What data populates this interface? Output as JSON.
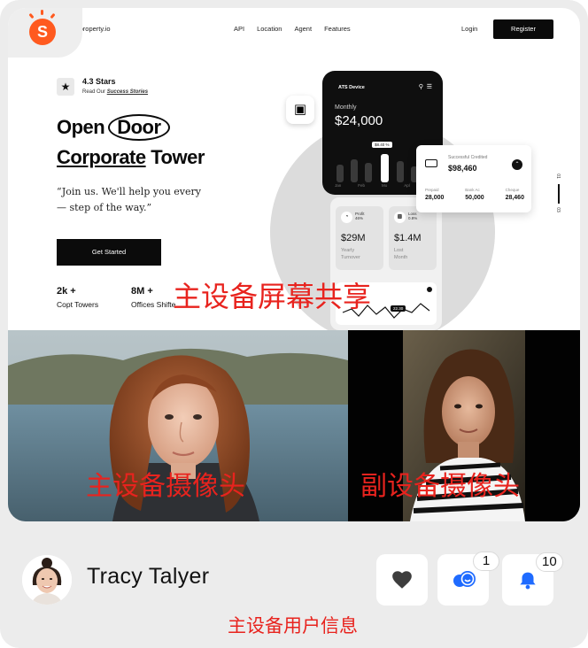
{
  "app": {
    "logo_icon": "app-logo-icon"
  },
  "website": {
    "email": "@property.io",
    "nav": [
      "API",
      "Location",
      "Agent",
      "Features"
    ],
    "login": "Login",
    "register": "Register",
    "rating": {
      "title": "4.3 Stars",
      "prefix": "Read Our ",
      "link": "Success Stories"
    },
    "hero": {
      "word_open": "Open",
      "word_door": "Door",
      "word_corporate": "Corporate",
      "word_tower": "Tower",
      "quote_line1": "“Join us. We'll help you every",
      "quote_line2": "—  step of the way.”",
      "cta": "Get Started"
    },
    "stats": [
      {
        "num": "2k +",
        "label": "Copt Towers"
      },
      {
        "num": "8M +",
        "label": "Offices Shifte"
      }
    ],
    "mockup": {
      "brand": "ATS Device",
      "monthly_label": "Monthly",
      "monthly_amount": "$24,000",
      "chip": "$8.40 %",
      "months": [
        "Jan",
        "Feb",
        "Mo",
        "Apl",
        "Mu"
      ],
      "profit_tag": "Profit",
      "profit_pct": "46%",
      "profit_value": "$29M",
      "profit_label_1": "Yearly",
      "profit_label_2": "Turnover",
      "loss_tag": "Loss",
      "loss_pct": "0.8%",
      "loss_value": "$1.4M",
      "loss_label_1": "Lost",
      "loss_label_2": "Month",
      "chart_chip": "22.30"
    },
    "credit_card": {
      "caption": "Successful Credited",
      "amount": "$98,460",
      "cols": [
        {
          "k": "Prepaid",
          "v": "28,000"
        },
        {
          "k": "Bank Ac",
          "v": "50,000"
        },
        {
          "k": "Cheque",
          "v": "28,460"
        }
      ]
    },
    "side_indicator": {
      "top": "01",
      "bottom": "03"
    }
  },
  "overlays": {
    "screen_share": "主设备屏幕共享",
    "main_camera": "主设备摄像头",
    "sub_camera": "副设备摄像头",
    "user_info": "主设备用户信息"
  },
  "user": {
    "name": "Tracy Talyer"
  },
  "actions": [
    {
      "name": "heart-icon",
      "badge": ""
    },
    {
      "name": "chat-bubbles-icon",
      "badge": "1"
    },
    {
      "name": "bell-icon",
      "badge": "10"
    }
  ],
  "colors": {
    "overlay_red": "#e8231e",
    "accent_blue": "#1f6bff",
    "logo_orange": "#ff5a1f"
  }
}
